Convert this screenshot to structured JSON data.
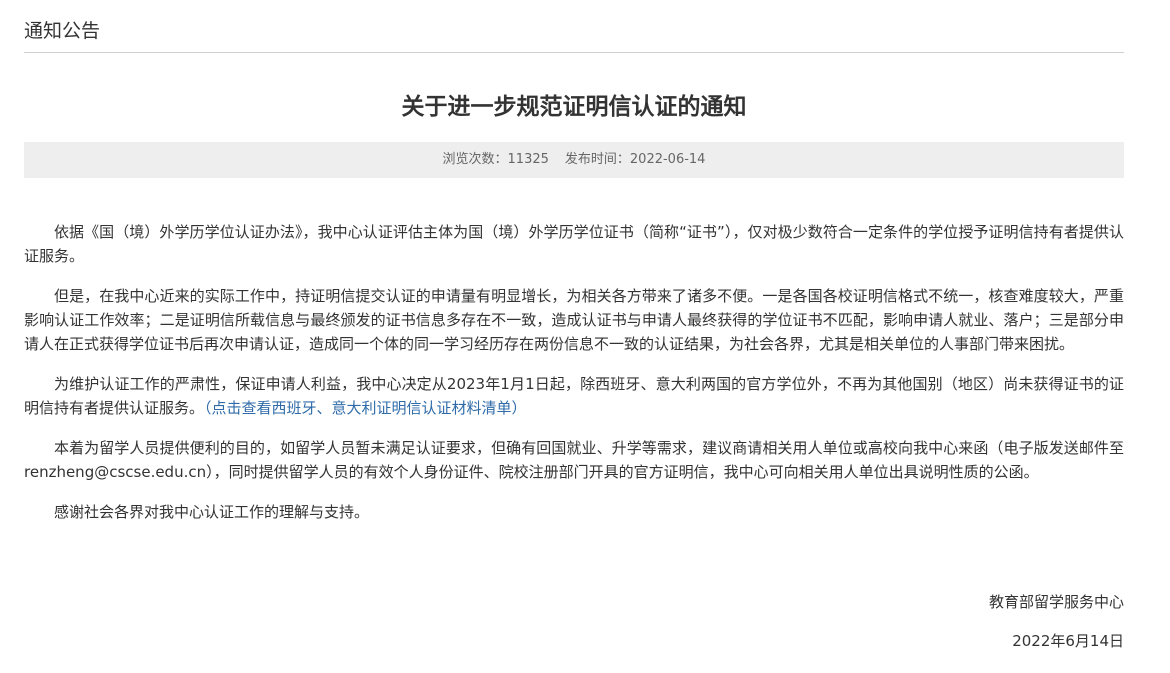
{
  "section": {
    "title": "通知公告"
  },
  "article": {
    "title": "关于进一步规范证明信认证的通知",
    "meta": {
      "views_label": "浏览次数：",
      "views": "11325",
      "date_label": "发布时间：",
      "date": "2022-06-14"
    },
    "paragraphs": {
      "p1": "依据《国（境）外学历学位认证办法》，我中心认证评估主体为国（境）外学历学位证书（简称“证书”），仅对极少数符合一定条件的学位授予证明信持有者提供认证服务。",
      "p2": "但是，在我中心近来的实际工作中，持证明信提交认证的申请量有明显增长，为相关各方带来了诸多不便。一是各国各校证明信格式不统一，核查难度较大，严重影响认证工作效率；二是证明信所载信息与最终颁发的证书信息多存在不一致，造成认证书与申请人最终获得的学位证书不匹配，影响申请人就业、落户；三是部分申请人在正式获得学位证书后再次申请认证，造成同一个体的同一学习经历存在两份信息不一致的认证结果，为社会各界，尤其是相关单位的人事部门带来困扰。",
      "p3_text": "为维护认证工作的严肃性，保证申请人利益，我中心决定从2023年1月1日起，除西班牙、意大利两国的官方学位外，不再为其他国别（地区）尚未获得证书的证明信持有者提供认证服务。",
      "p3_link": "（点击查看西班牙、意大利证明信认证材料清单）",
      "p4": "本着为留学人员提供便利的目的，如留学人员暂未满足认证要求，但确有回国就业、升学等需求，建议商请相关用人单位或高校向我中心来函（电子版发送邮件至renzheng@cscse.edu.cn），同时提供留学人员的有效个人身份证件、院校注册部门开具的官方证明信，我中心可向相关用人单位出具说明性质的公函。",
      "p5": "感谢社会各界对我中心认证工作的理解与支持。"
    },
    "signature": "教育部留学服务中心",
    "sign_date": "2022年6月14日"
  },
  "colors": {
    "text": "#333333",
    "meta_text": "#666666",
    "meta_bg": "#eeeeee",
    "link": "#2f6ba8",
    "divider": "#cfcfcf"
  }
}
